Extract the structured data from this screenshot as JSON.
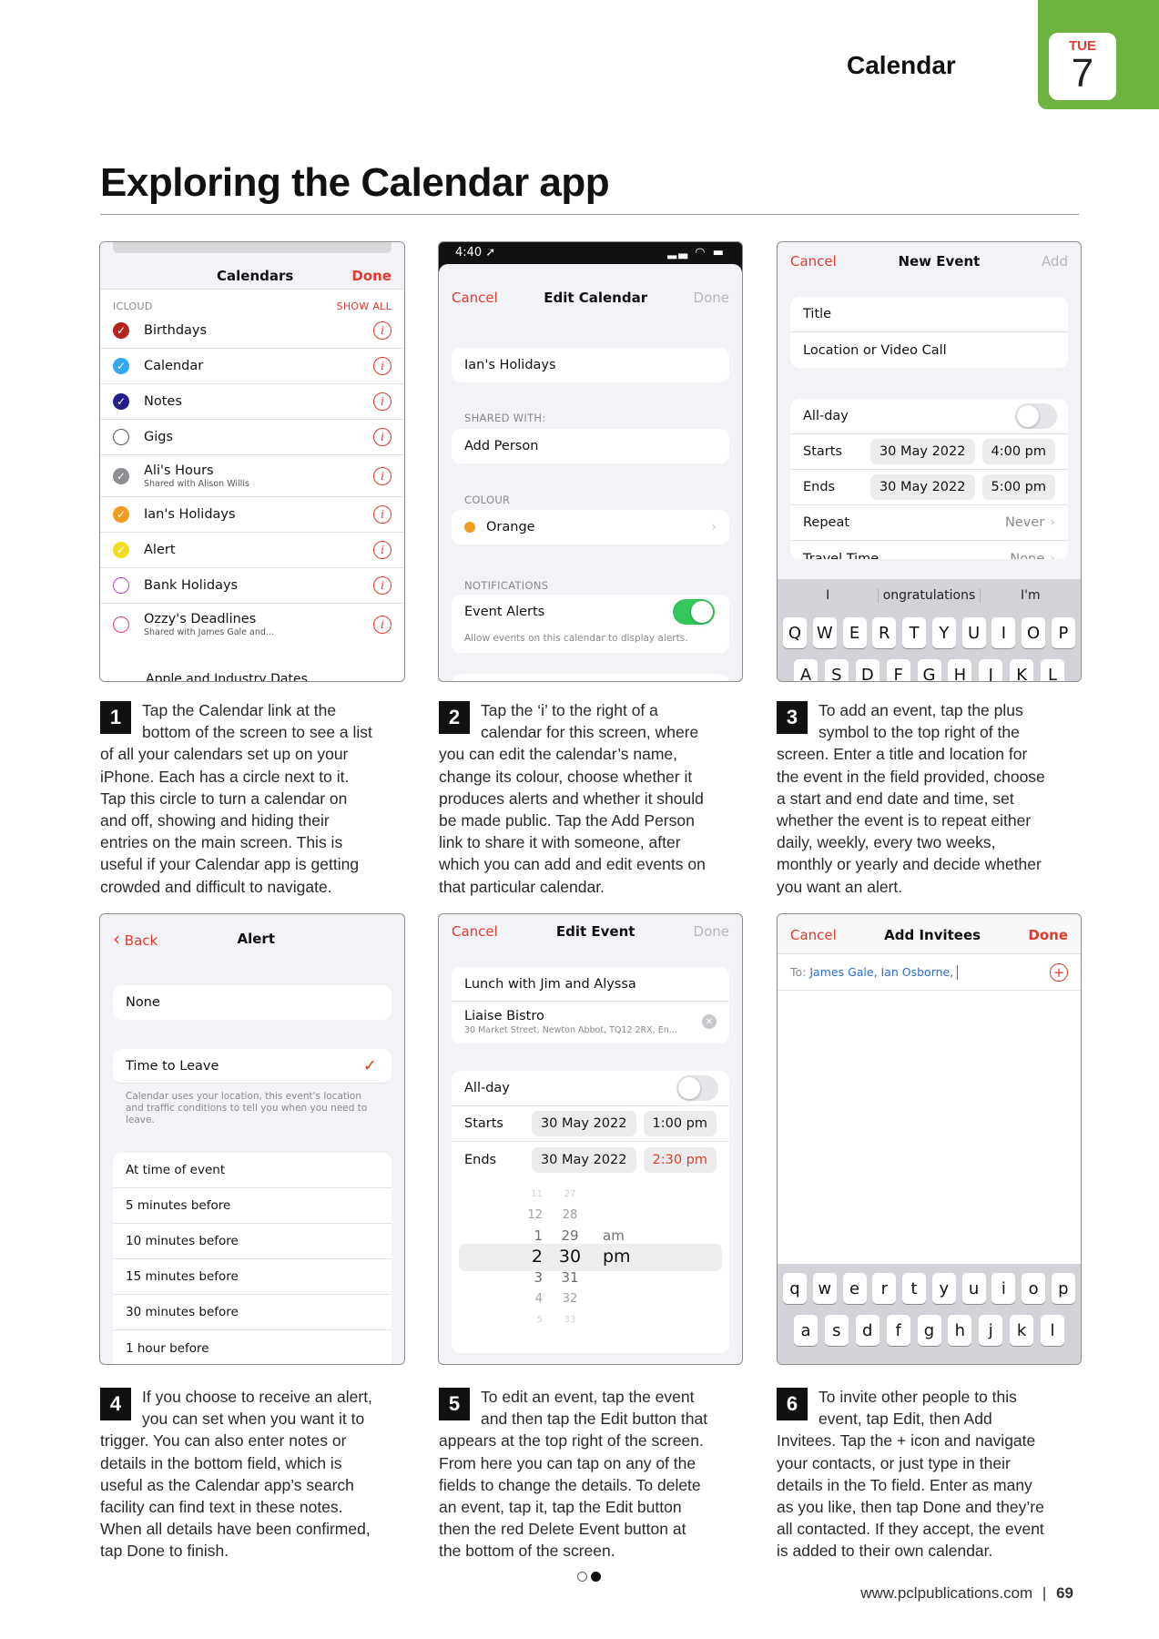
{
  "header": {
    "section": "Calendar",
    "day": "TUE",
    "date": "7"
  },
  "page_title": "Exploring the Calendar app",
  "s1": {
    "title": "Calendars",
    "done": "Done",
    "account": "ICLOUD",
    "show_all": "SHOW ALL",
    "items": [
      {
        "name": "Birthdays",
        "sub": "",
        "color": "#b3261e",
        "checked": true
      },
      {
        "name": "Calendar",
        "sub": "",
        "color": "#32a9f0",
        "checked": true
      },
      {
        "name": "Notes",
        "sub": "",
        "color": "#23208c",
        "checked": true
      },
      {
        "name": "Gigs",
        "sub": "",
        "color": "#555555",
        "checked": false
      },
      {
        "name": "Ali's Hours",
        "sub": "Shared with Alison Willis",
        "color": "#8e8e93",
        "checked": true
      },
      {
        "name": "Ian's Holidays",
        "sub": "",
        "color": "#f39a21",
        "checked": true
      },
      {
        "name": "Alert",
        "sub": "",
        "color": "#f1de20",
        "checked": true
      },
      {
        "name": "Bank Holidays",
        "sub": "",
        "color": "#b545c9",
        "checked": false
      },
      {
        "name": "Ozzy's Deadlines",
        "sub": "Shared with James Gale and...",
        "color": "#e7357a",
        "checked": false
      }
    ],
    "cut_item": "Apple and Industry Dates"
  },
  "s2": {
    "time": "4:40",
    "cancel": "Cancel",
    "title": "Edit Calendar",
    "done": "Done",
    "name": "Ian's Holidays",
    "shared_label": "SHARED WITH:",
    "add_person": "Add Person",
    "colour_label": "COLOUR",
    "colour": "Orange",
    "colour_hex": "#f39a21",
    "notif_label": "NOTIFICATIONS",
    "event_alerts": "Event Alerts",
    "alerts_note": "Allow events on this calendar to display alerts."
  },
  "s3": {
    "cancel": "Cancel",
    "title": "New Event",
    "add": "Add",
    "title_ph": "Title",
    "location_ph": "Location or Video Call",
    "allday": "All-day",
    "starts": "Starts",
    "start_date": "30 May 2022",
    "start_time": "4:00 pm",
    "ends": "Ends",
    "end_date": "30 May 2022",
    "end_time": "5:00 pm",
    "repeat": "Repeat",
    "repeat_val": "Never",
    "travel": "Travel Time",
    "travel_val": "None",
    "suggestions": [
      "I",
      "ongratulations",
      "I'm"
    ],
    "keys1": [
      "Q",
      "W",
      "E",
      "R",
      "T",
      "Y",
      "U",
      "I",
      "O",
      "P"
    ],
    "keys2": [
      "A",
      "S",
      "D",
      "F",
      "G",
      "H",
      "J",
      "K",
      "L"
    ]
  },
  "s4": {
    "back": "Back",
    "title": "Alert",
    "none": "None",
    "ttl": "Time to Leave",
    "ttl_note": "Calendar uses your location, this event's location and traffic conditions to tell you when you need to leave.",
    "options": [
      "At time of event",
      "5 minutes before",
      "10 minutes before",
      "15 minutes before",
      "30 minutes before",
      "1 hour before"
    ]
  },
  "s5": {
    "cancel": "Cancel",
    "title": "Edit Event",
    "done": "Done",
    "event": "Lunch with Jim and Alyssa",
    "place": "Liaise Bistro",
    "address": "30 Market Street, Newton Abbot, TQ12 2RX, En...",
    "allday": "All-day",
    "starts": "Starts",
    "start_date": "30 May 2022",
    "start_time": "1:00 pm",
    "ends": "Ends",
    "end_date": "30 May 2022",
    "end_time": "2:30 pm",
    "picker": {
      "hours": [
        "11",
        "12",
        "1",
        "2",
        "3",
        "4",
        "5"
      ],
      "mins": [
        "27",
        "28",
        "29",
        "30",
        "31",
        "32",
        "33"
      ],
      "ampm": [
        "am",
        "pm"
      ]
    }
  },
  "s6": {
    "cancel": "Cancel",
    "title": "Add Invitees",
    "done": "Done",
    "to_label": "To:",
    "invitees": "James Gale, Ian Osborne,",
    "keys1": [
      "q",
      "w",
      "e",
      "r",
      "t",
      "y",
      "u",
      "i",
      "o",
      "p"
    ],
    "keys2": [
      "a",
      "s",
      "d",
      "f",
      "g",
      "h",
      "j",
      "k",
      "l"
    ]
  },
  "steps": [
    {
      "n": "1",
      "text": "Tap the Calendar link at the bottom of the screen to see a list of all your calendars set up on your iPhone. Each has a circle next to it. Tap this circle to turn a calendar on and off, showing and hiding their entries on the main screen. This is useful if your Calendar app is getting crowded and difficult to navigate."
    },
    {
      "n": "2",
      "text": "Tap the ‘i’ to the right of a calendar for this screen, where you can edit the calendar’s name, change its colour, choose whether it produces alerts and whether it should be made public. Tap the Add Person link to share it with someone, after which you can add and edit events on that particular calendar."
    },
    {
      "n": "3",
      "text": "To add an event, tap the plus symbol to the top right of the screen. Enter a title and location for the event in the field provided, choose a start and end date and time, set whether the event is to repeat either daily, weekly, every two weeks, monthly or yearly and decide whether you want an alert."
    },
    {
      "n": "4",
      "text": "If you choose to receive an alert, you can set when you want it to trigger. You can also enter notes or details in the bottom field, which is useful as the Calendar app’s search facility can find text in these notes. When all details have been confirmed, tap Done to finish."
    },
    {
      "n": "5",
      "text": "To edit an event, tap the event and then tap the Edit button that appears at the top right of the screen. From here you can tap on any of the fields to change the details. To delete an event, tap it, tap the Edit button then the red Delete Event button at the bottom of the screen."
    },
    {
      "n": "6",
      "text": "To invite other people to this event, tap Edit, then Add Invitees. Tap the + icon and navigate your contacts, or just type in their details in the To field. Enter as many as you like, then tap Done and they’re all contacted. If they accept, the event is added to their own calendar."
    }
  ],
  "footer": {
    "url": "www.pclpublications.com",
    "sep": "|",
    "page": "69"
  },
  "colors": {
    "accent_green": "#6cb33f",
    "ios_red": "#e23b2c",
    "ios_green": "#34c759"
  }
}
